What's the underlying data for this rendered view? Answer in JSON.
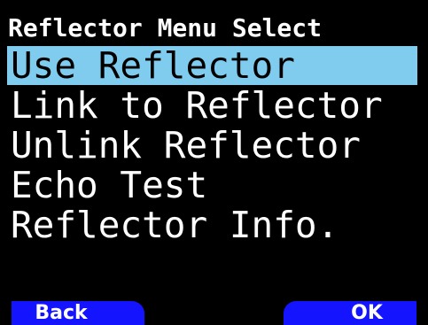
{
  "header": {
    "title": "Reflector Menu Select"
  },
  "menu": {
    "items": [
      {
        "label": "Use Reflector",
        "selected": true
      },
      {
        "label": "Link to Reflector",
        "selected": false
      },
      {
        "label": "Unlink Reflector",
        "selected": false
      },
      {
        "label": "Echo Test",
        "selected": false
      },
      {
        "label": "Reflector Info.",
        "selected": false
      }
    ]
  },
  "softkeys": {
    "left_label": "Back",
    "right_label": "OK"
  },
  "colors": {
    "background": "#000000",
    "selection": "#7fccef",
    "softkey": "#1414ff",
    "text": "#ffffff"
  }
}
